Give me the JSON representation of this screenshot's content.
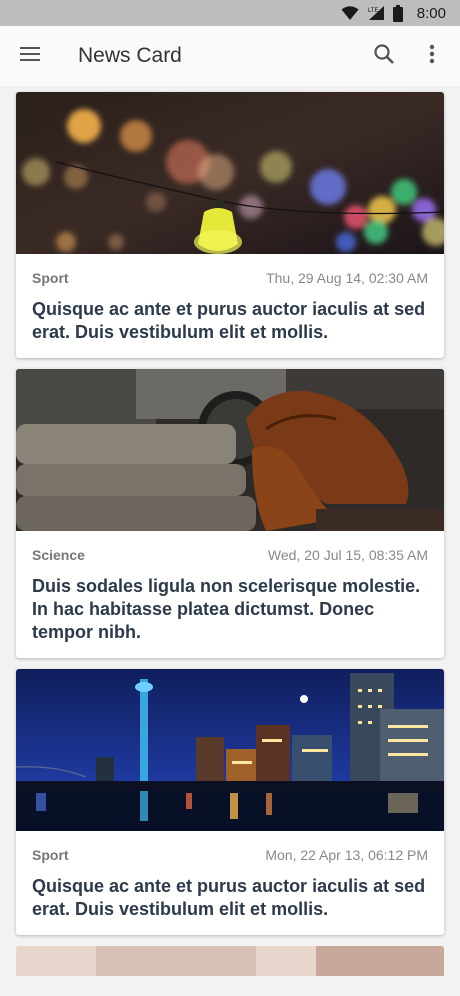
{
  "status_bar": {
    "time": "8:00",
    "network": "LTE"
  },
  "app_bar": {
    "title": "News Card"
  },
  "cards": [
    {
      "category": "Sport",
      "date": "Thu, 29 Aug 14, 02:30 AM",
      "headline": "Quisque ac ante et purus auctor iaculis at sed erat. Duis vestibulum elit et mollis.",
      "image": "bokeh-lights-image"
    },
    {
      "category": "Science",
      "date": "Wed, 20 Jul 15, 08:35 AM",
      "headline": "Duis sodales ligula non scelerisque molestie. In hac habitasse platea dictumst. Donec tempor nibh.",
      "image": "shoes-and-clothes-image"
    },
    {
      "category": "Sport",
      "date": "Mon, 22 Apr 13, 06:12 PM",
      "headline": "Quisque ac ante et purus auctor iaculis at sed erat. Duis vestibulum elit et mollis.",
      "image": "night-city-image"
    }
  ]
}
